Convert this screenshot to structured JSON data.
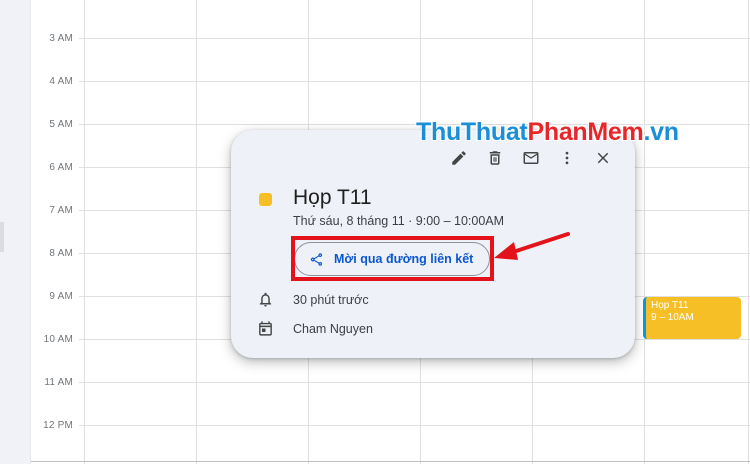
{
  "time_labels": [
    "3 AM",
    "4 AM",
    "5 AM",
    "6 AM",
    "7 AM",
    "8 AM",
    "9 AM",
    "10 AM",
    "11 AM",
    "12 PM"
  ],
  "side_event": {
    "title": "Họp T11",
    "time": "9 – 10AM",
    "color": "#f6bf26",
    "accent": "#039be5"
  },
  "popup": {
    "toolbar_icons": [
      "pencil-icon",
      "trash-icon",
      "mail-icon",
      "more-vert-icon",
      "close-icon"
    ],
    "color": "#f6bf26",
    "title": "Họp T11",
    "date_time": "Thứ sáu, 8 tháng 11 · 9:00 – 10:00AM",
    "share_label": "Mời qua đường liên kết",
    "reminder": "30 phút trước",
    "organizer": "Cham Nguyen"
  },
  "annotation": {
    "color": "#e3121b"
  },
  "watermark": {
    "part1": "ThuThuat",
    "part2": "PhanMem",
    "part3": ".vn"
  }
}
